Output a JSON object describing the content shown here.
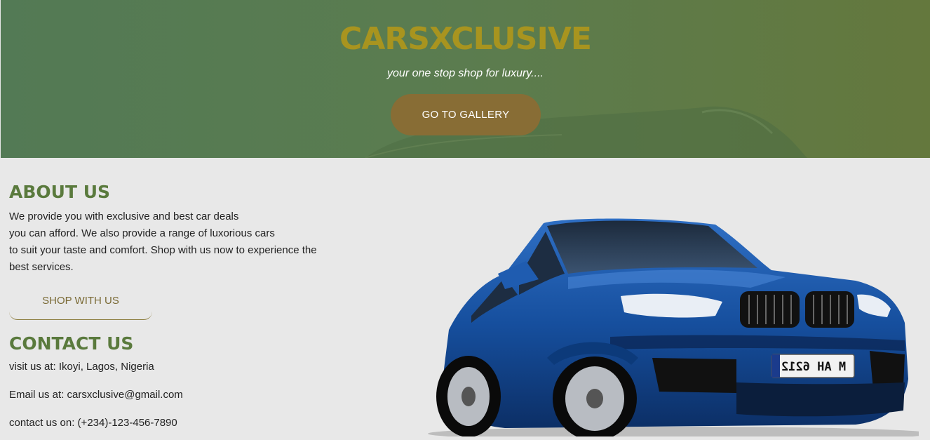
{
  "hero": {
    "brand": "CARSXCLUSIVE",
    "tagline": "your one stop shop for luxury....",
    "gallery_button": "GO TO GALLERY"
  },
  "about": {
    "title": "ABOUT US",
    "lines": [
      "We provide you with exclusive and best car deals",
      "you can afford. We also provide a range of luxorious cars",
      "to suit your taste and comfort. Shop with us now to experience the",
      "best services."
    ],
    "shop_button": "SHOP WITH US"
  },
  "contact": {
    "title": "CONTACT US",
    "address": "visit us at: Ikoyi, Lagos, Nigeria",
    "email": "Email us at: carsxclusive@gmail.com",
    "phone": "contact us on: (+234)-123-456-7890"
  },
  "car_image": {
    "plate": "M AH 6212",
    "icon": "car-photo"
  },
  "colors": {
    "brand": "#a8941f",
    "accent": "#886d35",
    "heading": "#5a7a3d"
  }
}
